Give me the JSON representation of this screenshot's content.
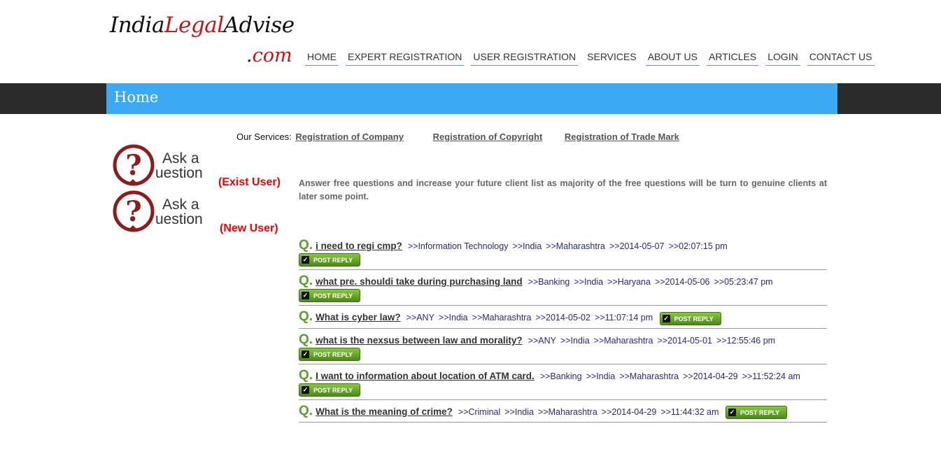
{
  "site": {
    "logo_part1": "India",
    "logo_part2": "Legal",
    "logo_part3": "Advise",
    "logo_dot": ".",
    "logo_com": "com"
  },
  "nav": [
    {
      "label": "HOME"
    },
    {
      "label": "EXPERT REGISTRATION"
    },
    {
      "label": "USER REGISTRATION"
    },
    {
      "label": "SERVICES"
    },
    {
      "label": "ABOUT US"
    },
    {
      "label": "ARTICLES"
    },
    {
      "label": "LOGIN"
    },
    {
      "label": "CONTACT US"
    }
  ],
  "page_title": "Home",
  "services": {
    "label": "Our Services:",
    "links": [
      "Registration of Company",
      "Registration of Copyright",
      "Registration of Trade Mark"
    ]
  },
  "ask": {
    "exist_caption": "(Exist User)",
    "new_caption": "(New User)",
    "logo_text_top": "Ask a",
    "logo_text_bottom": "uestion"
  },
  "intro": "Answer free questions and increase your future client list as majority of the free questions will be turn to genuine clients at later some point.",
  "q_marker": "Q.",
  "reply_label": "POST REPLY",
  "questions": [
    {
      "title": "i need to regi cmp?",
      "category": ">>Information Technology",
      "country": ">>India",
      "state": ">>Maharashtra",
      "date": ">>2014-05-07",
      "time": ">>02:07:15 pm"
    },
    {
      "title": "what pre. shouldi take during purchasing land",
      "category": ">>Banking",
      "country": ">>India",
      "state": ">>Haryana",
      "date": ">>2014-05-06",
      "time": ">>05:23:47 pm"
    },
    {
      "title": "What is cyber law?",
      "category": ">>ANY",
      "country": ">>India",
      "state": ">>Maharashtra",
      "date": ">>2014-05-02",
      "time": ">>11:07:14 pm"
    },
    {
      "title": "what is the nexsus between law and morality?",
      "category": ">>ANY",
      "country": ">>India",
      "state": ">>Maharashtra",
      "date": ">>2014-05-01",
      "time": ">>12:55:46 pm"
    },
    {
      "title": "I want to information about location of ATM card.",
      "category": ">>Banking",
      "country": ">>India",
      "state": ">>Maharashtra",
      "date": ">>2014-04-29",
      "time": ">>11:52:24 am"
    },
    {
      "title": "What is the meaning of crime?",
      "category": ">>Criminal",
      "country": ">>India",
      "state": ">>Maharashtra",
      "date": ">>2014-04-29",
      "time": ">>11:44:32 am"
    }
  ]
}
